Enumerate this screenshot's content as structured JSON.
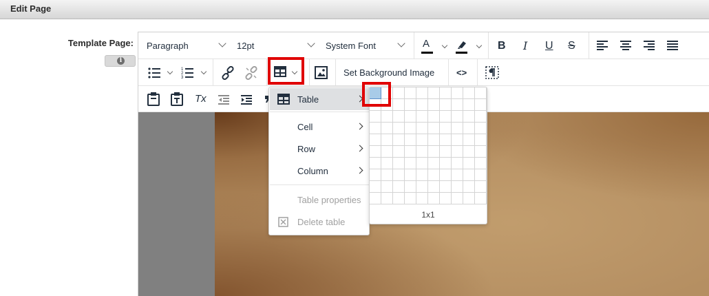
{
  "header": {
    "title": "Edit Page"
  },
  "form": {
    "label": "Template Page:",
    "info_icon": "i"
  },
  "toolbar": {
    "block_format": "Paragraph",
    "font_size": "12pt",
    "font_family": "System Font",
    "text_color_glyph": "A",
    "bold": "B",
    "italic": "I",
    "underline": "U",
    "strikethrough": "S",
    "set_background_label": "Set Background Image",
    "source_code_glyph": "<>",
    "clear_format_glyph": "Tx"
  },
  "table_menu": {
    "items": [
      {
        "label": "Table",
        "has_submenu": true,
        "active": true
      },
      {
        "label": "Cell",
        "has_submenu": true
      },
      {
        "label": "Row",
        "has_submenu": true
      },
      {
        "label": "Column",
        "has_submenu": true
      },
      {
        "label": "Table properties",
        "disabled": true
      },
      {
        "label": "Delete table",
        "disabled": true
      }
    ]
  },
  "table_grid": {
    "size_label": "1x1",
    "rows": 10,
    "cols": 10,
    "selected_rows": 1,
    "selected_cols": 1
  },
  "colors": {
    "highlight": "#e00000",
    "selection": "#a8cbe8",
    "paper": "#b58f62",
    "canvas_gray": "#808080"
  }
}
